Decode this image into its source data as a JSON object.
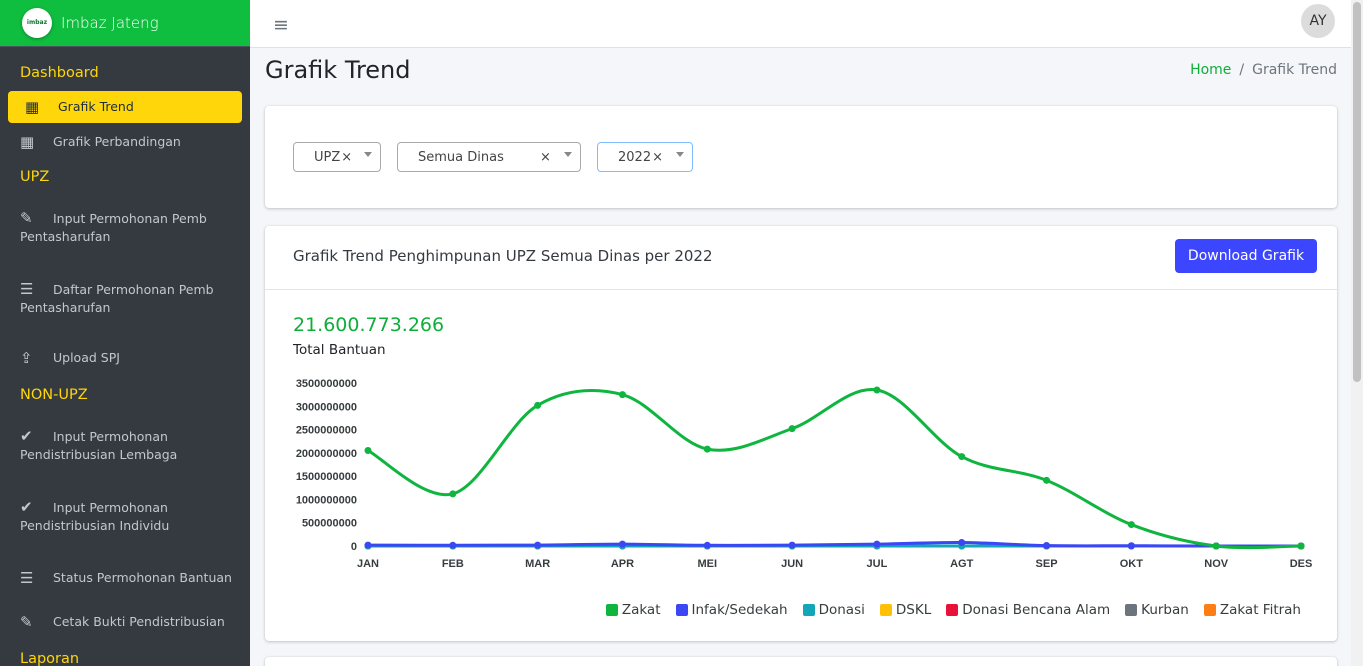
{
  "brand": {
    "name": "Imbaz Jateng",
    "logo_text": "imbaz"
  },
  "sidebar": {
    "sections": [
      {
        "header": "Dashboard",
        "items": [
          {
            "label": "Grafik Trend",
            "icon": "grid-icon",
            "active": true
          },
          {
            "label": "Grafik Perbandingan",
            "icon": "grid-icon"
          }
        ]
      },
      {
        "header": "UPZ",
        "items": [
          {
            "label": "Input Permohonan Pemb Pentasharufan",
            "icon": "edit-icon"
          },
          {
            "label": "Daftar Permohonan Pemb Pentasharufan",
            "icon": "checklist-icon"
          },
          {
            "label": "Upload SPJ",
            "icon": "upload-icon"
          }
        ]
      },
      {
        "header": "NON-UPZ",
        "items": [
          {
            "label": "Input Permohonan Pendistribusian Lembaga",
            "icon": "check-icon"
          },
          {
            "label": "Input Permohonan Pendistribusian Individu",
            "icon": "check-icon"
          },
          {
            "label": "Status Permohonan Bantuan",
            "icon": "list-icon"
          },
          {
            "label": "Cetak Bukti Pendistribusian",
            "icon": "edit-icon"
          }
        ]
      },
      {
        "header": "Laporan",
        "items": []
      }
    ]
  },
  "topbar": {
    "menu_icon": "hamburger-icon",
    "avatar": "AY"
  },
  "page": {
    "title": "Grafik Trend"
  },
  "breadcrumb": {
    "home": "Home",
    "separator": "/",
    "current": "Grafik Trend"
  },
  "filters": {
    "type": {
      "value": "UPZ",
      "clear": "×"
    },
    "dinas": {
      "value": "Semua Dinas",
      "clear": "×"
    },
    "year": {
      "value": "2022",
      "clear": "×"
    }
  },
  "chart_card": {
    "title": "Grafik Trend Penghimpunan UPZ Semua Dinas per 2022",
    "download_label": "Download Grafik",
    "total_value": "21.600.773.266",
    "total_label": "Total Bantuan"
  },
  "colors": {
    "accent": "#0fbd3f",
    "highlight": "#ffd60a",
    "button": "#3d46ff"
  },
  "chart_data": {
    "type": "line",
    "categories": [
      "JAN",
      "FEB",
      "MAR",
      "APR",
      "MEI",
      "JUN",
      "JUL",
      "AGT",
      "SEP",
      "OKT",
      "NOV",
      "DES"
    ],
    "ylim": [
      0,
      3500000000
    ],
    "y_ticks": [
      0,
      500000000,
      1000000000,
      1500000000,
      2000000000,
      2500000000,
      3000000000,
      3500000000
    ],
    "series": [
      {
        "name": "Zakat",
        "color": "#0fb53f",
        "values": [
          2050000000,
          1120000000,
          3020000000,
          3250000000,
          2080000000,
          2520000000,
          3350000000,
          1920000000,
          1410000000,
          460000000,
          0,
          0
        ]
      },
      {
        "name": "Infak/Sedekah",
        "color": "#3b47f5",
        "values": [
          20000000,
          15000000,
          20000000,
          40000000,
          15000000,
          20000000,
          40000000,
          75000000,
          10000000,
          5000000,
          0,
          0
        ]
      },
      {
        "name": "Donasi",
        "color": "#13a5b8",
        "values": [
          0,
          0,
          0,
          0,
          0,
          0,
          0,
          0,
          0,
          0,
          0,
          0
        ]
      },
      {
        "name": "DSKL",
        "color": "#ffc107",
        "values": [
          0,
          0,
          0,
          0,
          0,
          0,
          0,
          0,
          0,
          0,
          0,
          0
        ]
      },
      {
        "name": "Donasi Bencana Alam",
        "color": "#e8113a",
        "values": [
          0,
          0,
          0,
          0,
          0,
          0,
          0,
          0,
          0,
          0,
          0,
          0
        ]
      },
      {
        "name": "Kurban",
        "color": "#6c757d",
        "values": [
          0,
          0,
          0,
          0,
          0,
          0,
          0,
          0,
          0,
          0,
          0,
          0
        ]
      },
      {
        "name": "Zakat Fitrah",
        "color": "#fd7e14",
        "values": [
          0,
          0,
          0,
          0,
          0,
          0,
          0,
          0,
          0,
          0,
          0,
          0
        ]
      }
    ],
    "legend_position": "bottom-right",
    "grid": false
  }
}
